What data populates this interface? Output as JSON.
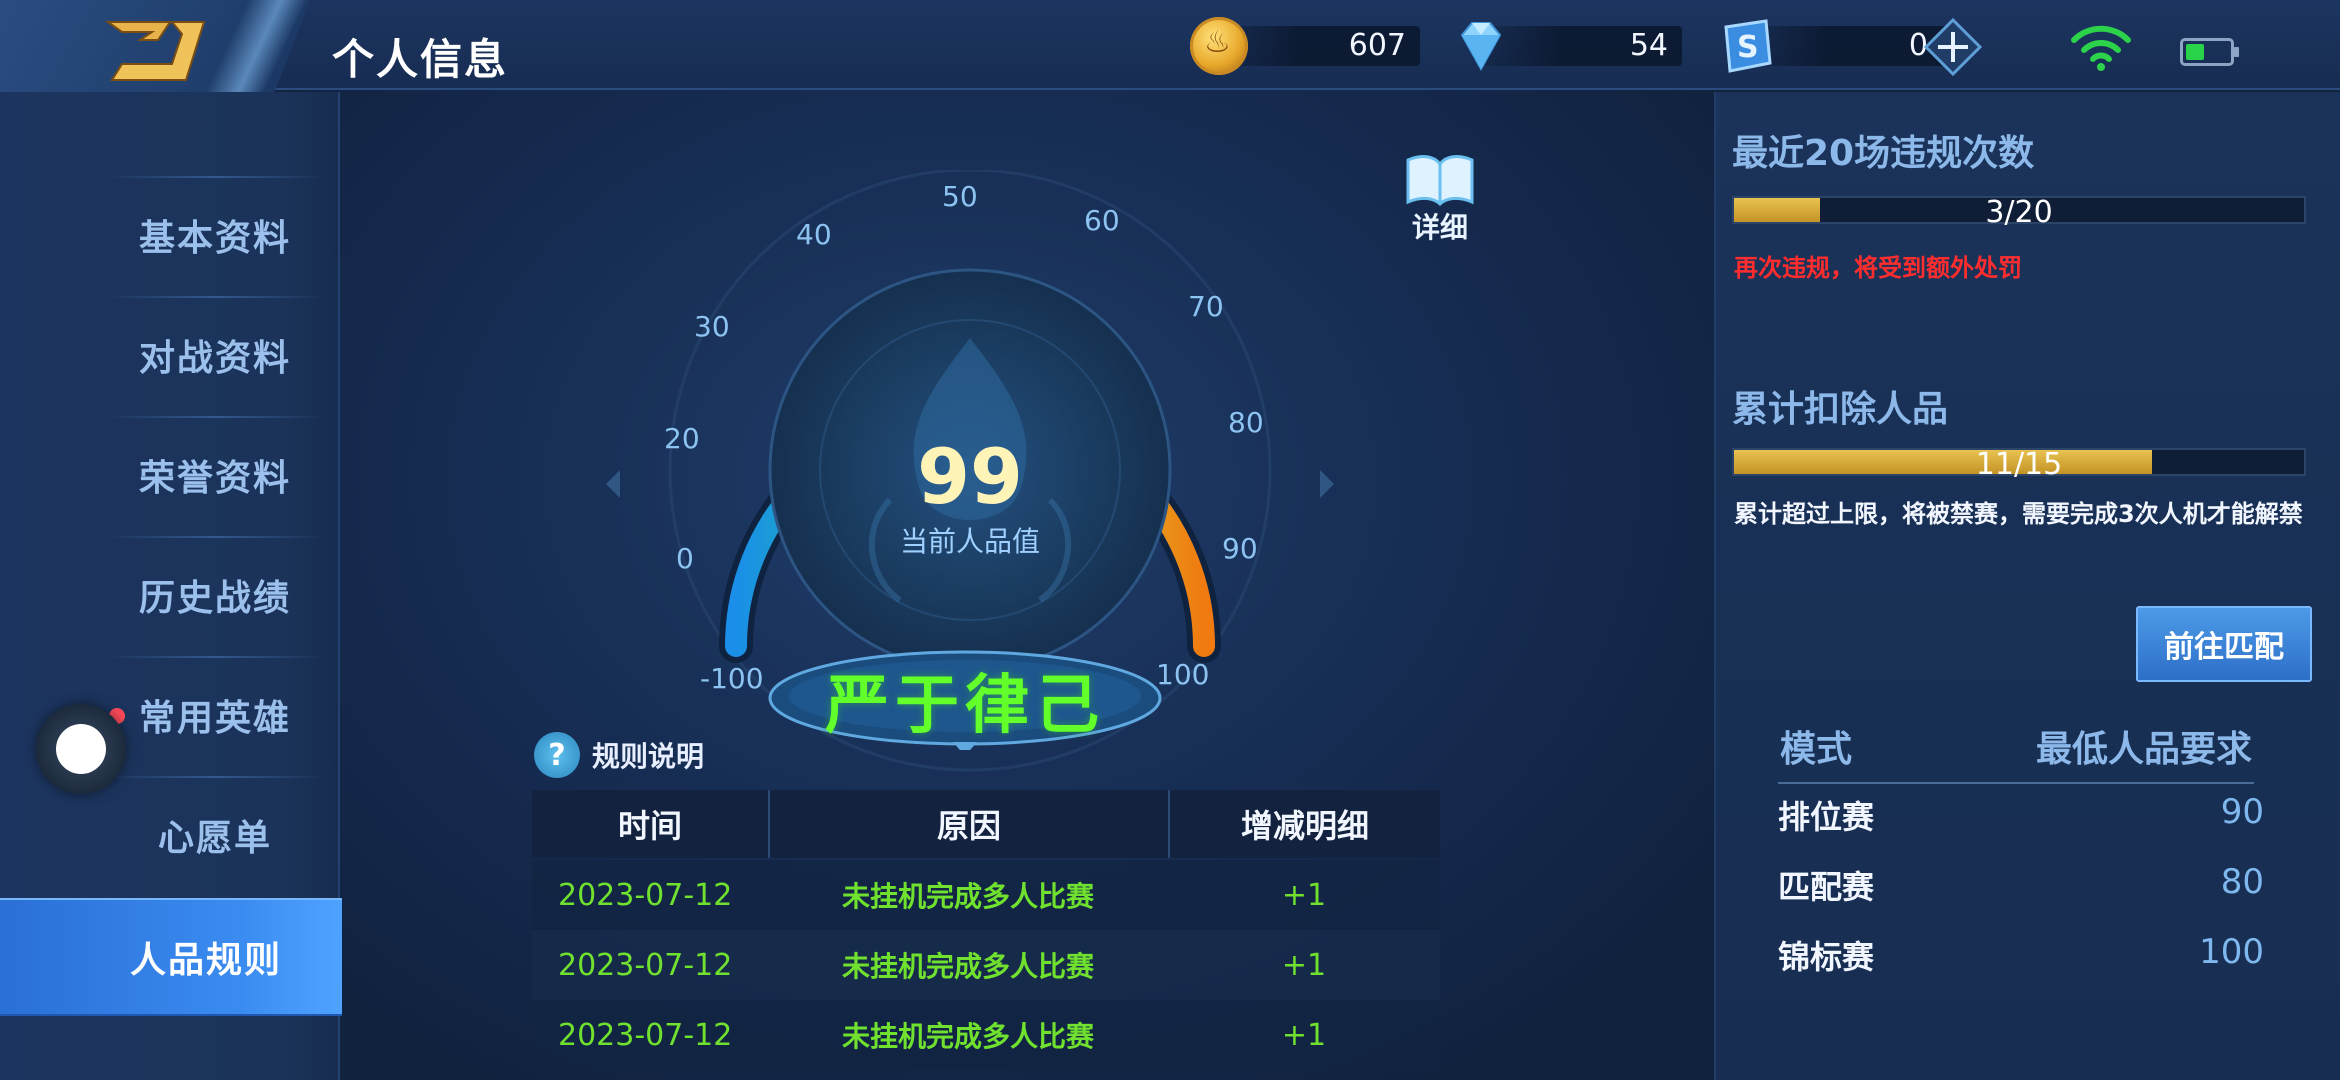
{
  "header": {
    "title": "个人信息",
    "back_icon": "back-arrow-icon",
    "currencies": [
      {
        "icon": "gold-coin-icon",
        "value": "607"
      },
      {
        "icon": "diamond-icon",
        "value": "54"
      },
      {
        "icon": "token-icon",
        "value": "0"
      }
    ]
  },
  "sidebar": {
    "items": [
      {
        "label": "基本资料"
      },
      {
        "label": "对战资料"
      },
      {
        "label": "荣誉资料"
      },
      {
        "label": "历史战绩"
      },
      {
        "label": "常用英雄"
      },
      {
        "label": "心愿单"
      },
      {
        "label": "人品规则"
      }
    ],
    "active_index": 6
  },
  "gauge": {
    "ticks": [
      "-100",
      "0",
      "20",
      "30",
      "40",
      "50",
      "60",
      "70",
      "80",
      "90",
      "100"
    ],
    "score": "99",
    "score_label": "当前人品值",
    "rank": "严于律己",
    "detail_label": "详细"
  },
  "rules": {
    "label": "规则说明",
    "columns": [
      "时间",
      "原因",
      "增减明细"
    ],
    "rows": [
      [
        "2023-07-12",
        "未挂机完成多人比赛",
        "+1"
      ],
      [
        "2023-07-12",
        "未挂机完成多人比赛",
        "+1"
      ],
      [
        "2023-07-12",
        "未挂机完成多人比赛",
        "+1"
      ]
    ]
  },
  "violations": {
    "title": "最近20场违规次数",
    "progress_text": "3/20",
    "progress": 0.15,
    "warning": "再次违规，将受到额外处罚"
  },
  "deduction": {
    "title": "累计扣除人品",
    "progress_text": "11/15",
    "progress": 0.733,
    "note": "累计超过上限，将被禁赛，需要完成3次人机才能解禁"
  },
  "match_button": "前往匹配",
  "requirements": {
    "col_mode": "模式",
    "col_min": "最低人品要求",
    "rows": [
      {
        "mode": "排位赛",
        "min": "90"
      },
      {
        "mode": "匹配赛",
        "min": "80"
      },
      {
        "mode": "锦标赛",
        "min": "100"
      }
    ]
  },
  "colors": {
    "accent_blue": "#3a8bf0",
    "rank_green": "#62ff2a",
    "warning_red": "#ff2d2d",
    "bar_gold": "#d8ac36"
  }
}
